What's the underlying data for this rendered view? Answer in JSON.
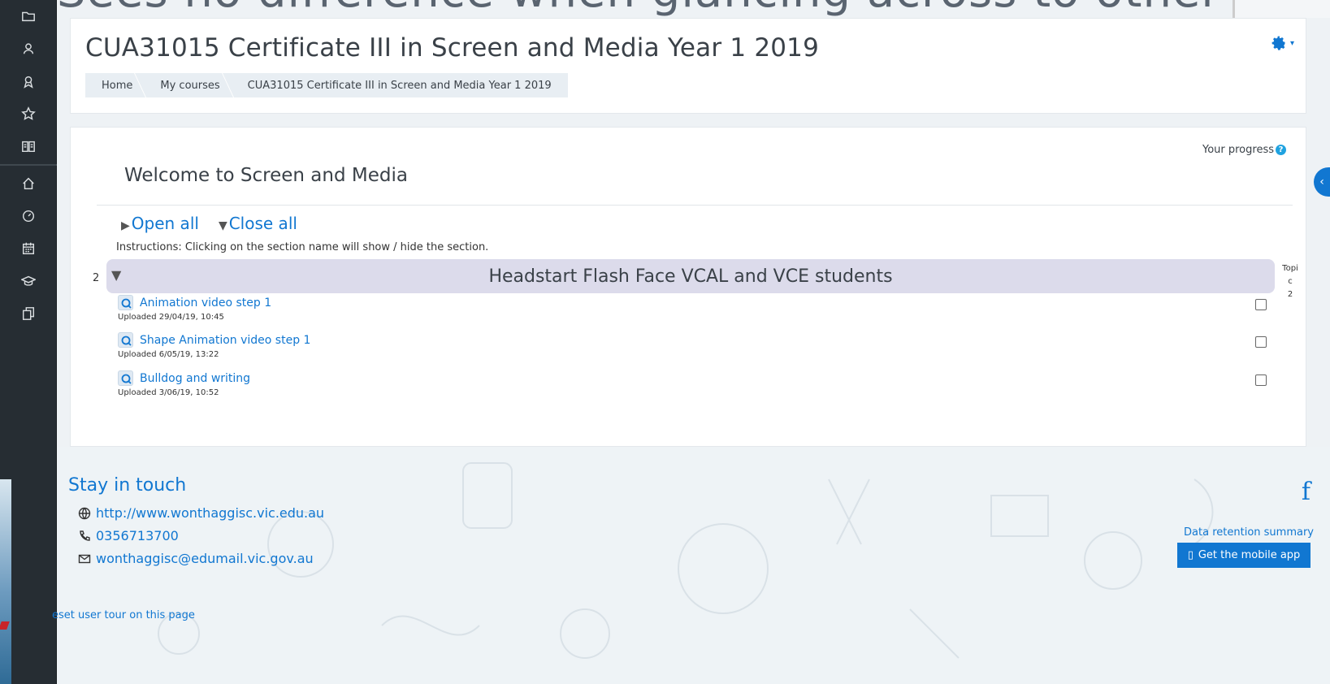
{
  "overlay": {
    "text": "Sees no difference when glancing across to others."
  },
  "sidebar": {
    "icons": [
      "folder-icon",
      "users-icon",
      "award-icon",
      "star-icon",
      "book-icon",
      "home-icon",
      "dashboard-icon",
      "calendar-icon",
      "graduation-cap-icon",
      "copy-icon"
    ]
  },
  "header": {
    "title": "CUA31015 Certificate III in Screen and Media Year 1 2019",
    "breadcrumb": [
      "Home",
      "My courses",
      "CUA31015 Certificate III in Screen and Media Year 1 2019"
    ]
  },
  "main": {
    "progress_label": "Your progress",
    "help_glyph": "?",
    "welcome": "Welcome to Screen and Media",
    "open_all": "Open all",
    "close_all": "Close all",
    "instructions": "Instructions: Clicking on the section name will show / hide the section.",
    "section": {
      "number": "2",
      "title": "Headstart Flash Face VCAL and VCE students",
      "side_label_lines": [
        "Topi",
        "c",
        "2"
      ]
    },
    "activities": [
      {
        "name": "Animation video step 1",
        "meta": "Uploaded 29/04/19, 10:45"
      },
      {
        "name": "Shape Animation video step 1",
        "meta": "Uploaded 6/05/19, 13:22"
      },
      {
        "name": "Bulldog and writing",
        "meta": "Uploaded 3/06/19, 10:52"
      }
    ]
  },
  "footer": {
    "stay_in_touch": "Stay in touch",
    "website": "http://www.wonthaggisc.vic.edu.au",
    "phone": "0356713700",
    "email": "wonthaggisc@edumail.vic.gov.au",
    "data_retention": "Data retention summary",
    "mobile_app": "Get the mobile app",
    "reset_tour": "eset user tour on this page"
  },
  "colors": {
    "accent": "#1177d1",
    "sidebar": "#262d33",
    "section_bar": "#dcdbeb"
  }
}
